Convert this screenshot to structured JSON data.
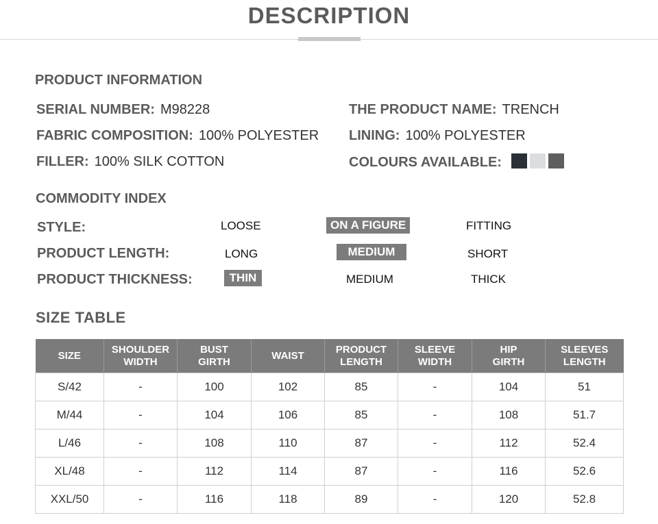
{
  "title": "DESCRIPTION",
  "product_info": {
    "heading": "PRODUCT INFORMATION",
    "serial_number": {
      "label": "SERIAL NUMBER:",
      "value": "M98228"
    },
    "product_name": {
      "label": "THE PRODUCT NAME:",
      "value": "TRENCH"
    },
    "fabric": {
      "label": "FABRIC COMPOSITION:",
      "value": "100% POLYESTER"
    },
    "lining": {
      "label": "LINING:",
      "value": "100% POLYESTER"
    },
    "filler": {
      "label": "FILLER:",
      "value": "100% SILK COTTON"
    },
    "colours": {
      "label": "COLOURS AVAILABLE:",
      "swatches": [
        "#2b3037",
        "#dcdde0",
        "#5e5e5e"
      ]
    }
  },
  "commodity_index": {
    "heading": "COMMODITY INDEX",
    "rows": [
      {
        "label": "STYLE:",
        "options": [
          "LOOSE",
          "ON A FIGURE",
          "FITTING"
        ],
        "selected": 1
      },
      {
        "label": "PRODUCT LENGTH:",
        "options": [
          "LONG",
          "MEDIUM",
          "SHORT"
        ],
        "selected": 1
      },
      {
        "label": "PRODUCT THICKNESS:",
        "options": [
          "THIN",
          "MEDIUM",
          "THICK"
        ],
        "selected": 0
      }
    ]
  },
  "size_table": {
    "heading": "SIZE TABLE",
    "headers": [
      [
        "SIZE"
      ],
      [
        "SHOULDER",
        "WIDTH"
      ],
      [
        "BUST",
        "GIRTH"
      ],
      [
        "WAIST"
      ],
      [
        "PRODUCT",
        "LENGTH"
      ],
      [
        "SLEEVE",
        "WIDTH"
      ],
      [
        "HIP",
        "GIRTH"
      ],
      [
        "SLEEVES",
        "LENGTH"
      ]
    ],
    "rows": [
      [
        "S/42",
        "-",
        "100",
        "102",
        "85",
        "-",
        "104",
        "51"
      ],
      [
        "M/44",
        "-",
        "104",
        "106",
        "85",
        "-",
        "108",
        "51.7"
      ],
      [
        "L/46",
        "-",
        "108",
        "110",
        "87",
        "-",
        "112",
        "52.4"
      ],
      [
        "XL/48",
        "-",
        "112",
        "114",
        "87",
        "-",
        "116",
        "52.6"
      ],
      [
        "XXL/50",
        "-",
        "116",
        "118",
        "89",
        "-",
        "120",
        "52.8"
      ]
    ]
  }
}
